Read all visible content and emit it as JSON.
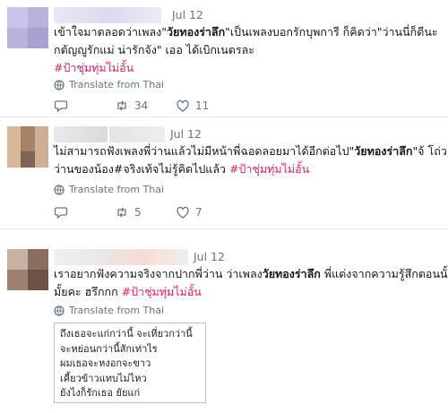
{
  "tweets": [
    {
      "date": "Jul 12",
      "lines": [
        {
          "pre": "เข้าใจมาตลอดว่าเพลง\"",
          "bold": "วัยทองร่าลึก",
          "post": "\"เป็นเพลงบอกรักบุพการี ก็คิดว่า\"ว่านนี่ก็ดีนะ"
        },
        {
          "pre": "กตัญญูรักแม่ น่ารักจัง\" เออ ได้เบิกเนตรละ"
        }
      ],
      "hashtag": "#ป้าชุ่มทุ่มไม่อั้น",
      "translate": "Translate from Thai",
      "actions": {
        "replies": "",
        "retweets": "34",
        "likes": "11"
      }
    },
    {
      "date": "Jul 12",
      "lines": [
        {
          "pre": "ไม่สามารถฟังเพลงพี่ว่านแล้วไม่มีหน้าพี่ฉอดลอยมาได้อีกต่อไป\"",
          "bold": "วัยทองร่าลึก",
          "post": "\"จ้ โถ่ว!พี่"
        },
        {
          "pre": "ว่านของน้อง#จริงเท้จไม่รู้คิดไปแล้ว "
        }
      ],
      "hashtag": "#ป้าชุ่มทุ่มไม่อั้น",
      "translate": "Translate from Thai",
      "actions": {
        "replies": "",
        "retweets": "5",
        "likes": "7"
      }
    },
    {
      "date": "Jul 12",
      "lines": [
        {
          "pre": "เราอยากฟังความจริงจากปากพี่ว่าน ว่าเพลง",
          "bold": "วัยทองร่าลึก",
          "post": " พี่แต่งจากความรู้สึกตอนนั้นใช่"
        },
        {
          "pre": "มั้ยคะ ฮรึกกก "
        }
      ],
      "hashtag": "#ป้าชุ่มทุ่มไม่อั้น",
      "translate": "Translate from Thai",
      "media_lines": [
        "ถึงเธอจะแก่กว่านี้ จะเหี่ยวกว่านี้",
        "จะหย่อนกว่านี้สักเท่าไร",
        "ผมเธอจะหงอกจะขาว",
        "เคี้ยวข้าวแทบไม่ไหว",
        "ยังไงก็รักเธอ ยัยแก่"
      ]
    }
  ],
  "icons": {
    "reply": "reply-icon",
    "retweet": "retweet-icon",
    "like": "heart-icon",
    "globe": "globe-icon"
  },
  "colors": {
    "hashtag": "#e0245e",
    "meta": "#657786",
    "divider": "#e1e8ed"
  }
}
